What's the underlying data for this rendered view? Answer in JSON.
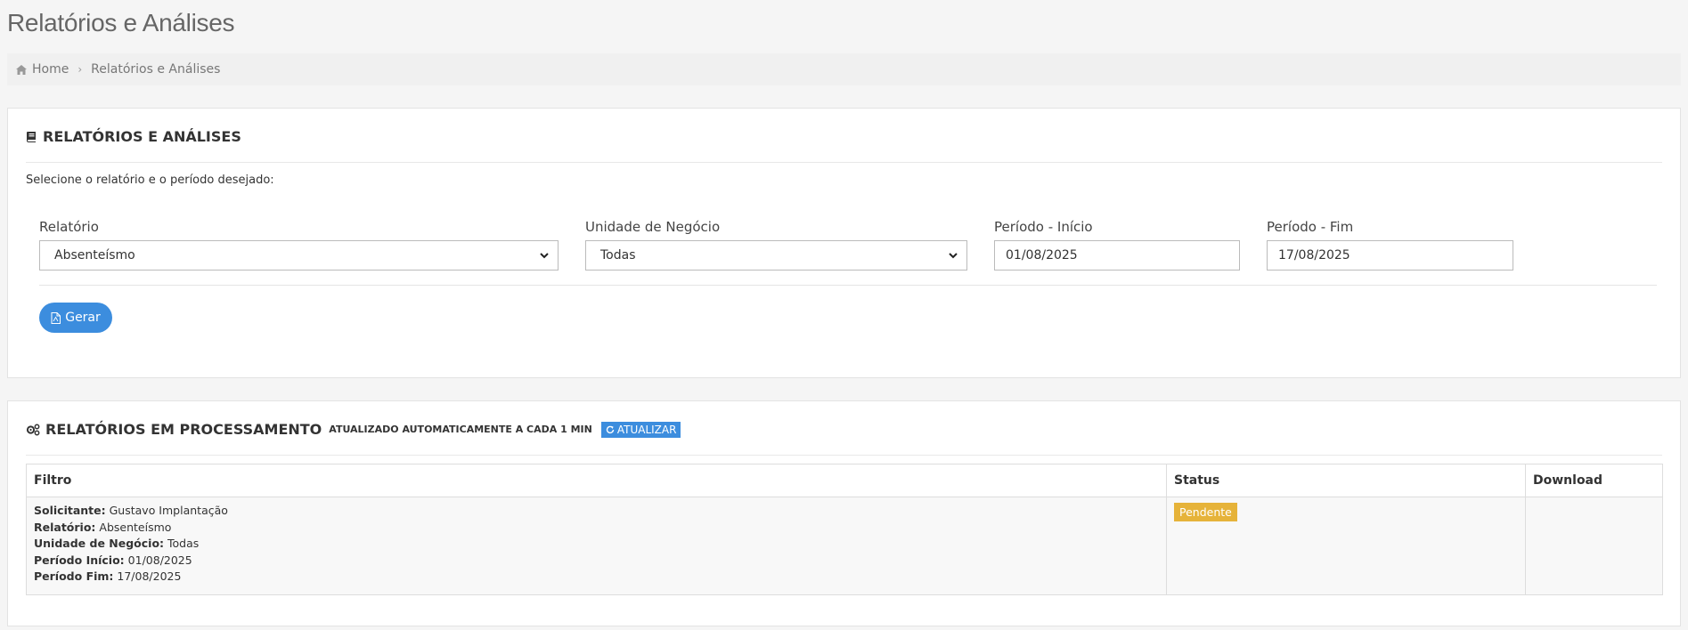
{
  "page": {
    "title": "Relatórios e Análises"
  },
  "breadcrumb": {
    "home": "Home",
    "current": "Relatórios e Análises"
  },
  "report_panel": {
    "title": "RELATÓRIOS E ANÁLISES",
    "intro": "Selecione o relatório e o período desejado:",
    "fields": {
      "relatorio": {
        "label": "Relatório",
        "value": "Absenteísmo"
      },
      "unidade": {
        "label": "Unidade de Negócio",
        "value": "Todas"
      },
      "inicio": {
        "label": "Período - Início",
        "value": "01/08/2025"
      },
      "fim": {
        "label": "Período - Fim",
        "value": "17/08/2025"
      }
    },
    "generate_label": "Gerar"
  },
  "processing_panel": {
    "title": "RELATÓRIOS EM PROCESSAMENTO",
    "subtitle": "ATUALIZADO AUTOMATICAMENTE A CADA 1 MIN",
    "refresh_label": "ATUALIZAR",
    "columns": {
      "filtro": "Filtro",
      "status": "Status",
      "download": "Download"
    },
    "rows": [
      {
        "solicitante_label": "Solicitante:",
        "solicitante": "Gustavo Implantação",
        "relatorio_label": "Relatório:",
        "relatorio": "Absenteísmo",
        "unidade_label": "Unidade de Negócio:",
        "unidade": "Todas",
        "inicio_label": "Período Início:",
        "inicio": "01/08/2025",
        "fim_label": "Período Fim:",
        "fim": "17/08/2025",
        "status": "Pendente",
        "status_color": "#e6b33a"
      }
    ]
  },
  "colors": {
    "accent": "#3c8dde",
    "pending": "#e6b33a"
  }
}
